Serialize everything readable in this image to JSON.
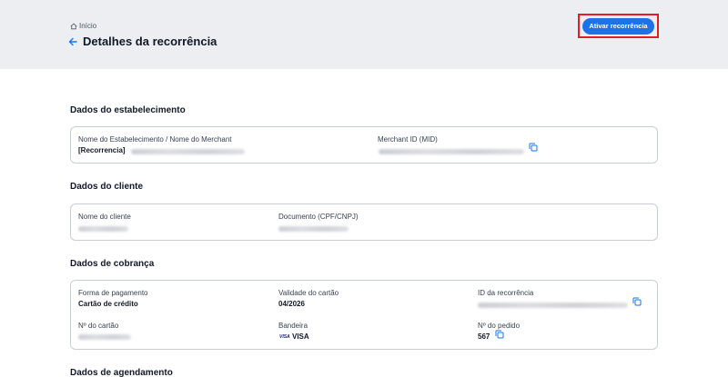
{
  "header": {
    "breadcrumb": "Início",
    "title": "Detalhes da recorrência",
    "activate_button": "Ativar recorrência"
  },
  "sections": {
    "establishment": {
      "title": "Dados do estabelecimento",
      "name_label": "Nome do Estabelecimento / Nome do Merchant",
      "name_value_prefix": "[Recorrencia]",
      "mid_label": "Merchant ID (MID)"
    },
    "client": {
      "title": "Dados do cliente",
      "name_label": "Nome do cliente",
      "document_label": "Documento (CPF/CNPJ)"
    },
    "billing": {
      "title": "Dados de cobrança",
      "payment_method_label": "Forma de pagamento",
      "payment_method_value": "Cartão de crédito",
      "card_validity_label": "Validade do cartão",
      "card_validity_value": "04/2026",
      "recurrence_id_label": "ID da recorrência",
      "card_number_label": "Nº do cartão",
      "brand_label": "Bandeira",
      "brand_value": "VISA",
      "brand_logo_text": "VISA",
      "order_number_label": "Nº do pedido",
      "order_number_value": "567"
    },
    "scheduling": {
      "title": "Dados de agendamento"
    }
  },
  "icons": {
    "home": "home-icon",
    "back": "arrow-left-icon",
    "copy": "copy-icon"
  },
  "colors": {
    "primary": "#1a73e8",
    "highlight": "#e11d2a",
    "header_bg": "#eceef1"
  }
}
